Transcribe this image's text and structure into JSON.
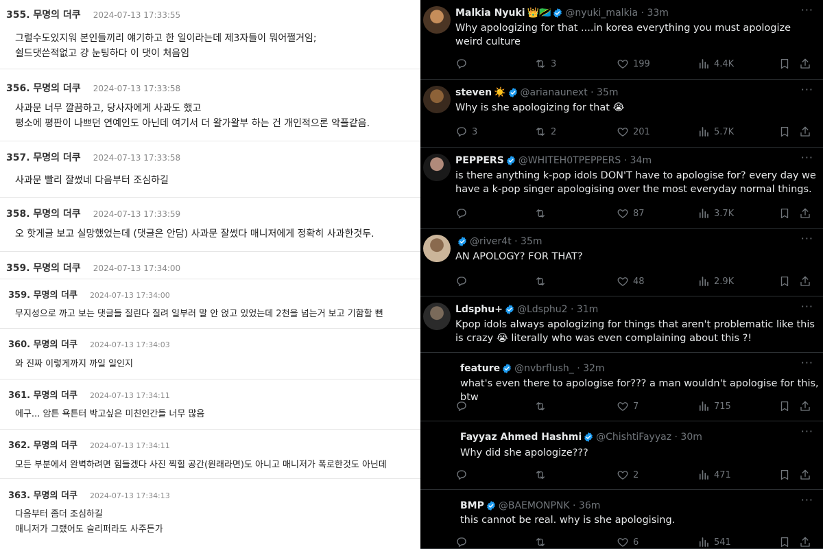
{
  "forum": {
    "comments": [
      {
        "num": "355. 무명의 더쿠",
        "time": "2024-07-13 17:33:55",
        "lines": [
          "그럴수도있지워 본인들끼리 얘기하고 한 일이라는데 제3자들이 뭐어쩔거임;",
          "쉴드댓쓴적없고 걍 눈팅하다 이 댓이 처음임"
        ]
      },
      {
        "num": "356. 무명의 더쿠",
        "time": "2024-07-13 17:33:58",
        "lines": [
          "사과문 너무 깔끔하고, 당사자에게 사과도 했고",
          "평소에 평판이 나쁘던 연예인도 아닌데 여기서 더 왈가왈부 하는 건 개인적으론 악플같음."
        ]
      },
      {
        "num": "357. 무명의 더쿠",
        "time": "2024-07-13 17:33:58",
        "lines": [
          "사과문 빨리 잘썼네 다음부터 조심하길"
        ]
      },
      {
        "num": "358. 무명의 더쿠",
        "time": "2024-07-13 17:33:59",
        "lines": [
          "오 핫게글 보고 실망했었는데 (댓글은 안담) 사과문 잘썼다 매니저에게 정확히 사과한것두."
        ]
      },
      {
        "num": "359. 무명의 더쿠",
        "time": "2024-07-13 17:34:00",
        "lines": []
      },
      {
        "num": "359. 무명의 더쿠",
        "time": "2024-07-13 17:34:00",
        "lines": [
          "무지성으로 까고 보는 댓글들 질린다 질려 일부러 말 안 얹고 있었는데 2천을 넘는거 보고 기함할 뻔"
        ]
      },
      {
        "num": "360. 무명의 더쿠",
        "time": "2024-07-13 17:34:03",
        "lines": [
          "와 진짜 이렇게까지 까일 일인지"
        ]
      },
      {
        "num": "361. 무명의 더쿠",
        "time": "2024-07-13 17:34:11",
        "lines": [
          "에구... 암튼 욕튼터 박고싶은 미친인간들 너무 많음"
        ]
      },
      {
        "num": "362. 무명의 더쿠",
        "time": "2024-07-13 17:34:11",
        "lines": [
          "모든 부분에서 완벽하려면 힘들겠다 사진 찍힐 공간(원래라면)도 아니고 매니저가 폭로한것도 아닌데"
        ]
      },
      {
        "num": "363. 무명의 더쿠",
        "time": "2024-07-13 17:34:13",
        "lines": [
          "다음부터 좀더 조심하길",
          "매니저가 그랬어도 슬리퍼라도 사주든가"
        ]
      }
    ]
  },
  "twitter": {
    "colors": {
      "background": "#000000",
      "text": "#e7e9ea",
      "muted": "#71767b",
      "verified": "#1d9bf0",
      "divider": "#2f3336"
    },
    "tweets": [
      {
        "name": "Malkia Nyuki",
        "emoji": "👑🇹🇿",
        "handle": "@nyuki_malkia",
        "time": "· 33m",
        "text": "Why apologizing for that ....in korea everything you must apologize weird culture",
        "replies": "",
        "retweets": "3",
        "likes": "199",
        "views": "4.4K"
      },
      {
        "name": "steven",
        "emoji": "☀️",
        "handle": "@arianaunext",
        "time": "· 35m",
        "text": "Why is she apologizing for that 😭",
        "replies": "3",
        "retweets": "2",
        "likes": "201",
        "views": "5.7K"
      },
      {
        "name": "PEPPERS",
        "emoji": "",
        "handle": "@WHITEH0TPEPPERS",
        "time": "· 34m",
        "text": "is there anything k-pop idols DON'T have to apologise for? every day we have a k-pop singer apologising over the most everyday normal things.",
        "replies": "",
        "retweets": "",
        "likes": "87",
        "views": "3.7K"
      },
      {
        "name": "",
        "emoji": "",
        "handle": "@river4t",
        "time": "· 35m",
        "text": "AN APOLOGY? FOR THAT?",
        "replies": "",
        "retweets": "",
        "likes": "48",
        "views": "2.9K"
      },
      {
        "name": "Ldsphu+",
        "emoji": "",
        "handle": "@Ldsphu2",
        "time": "· 31m",
        "text": "Kpop idols always apologizing for things that aren't problematic like this is crazy 😭 literally who was even complaining about this ?!",
        "replies": "",
        "retweets": "",
        "likes": "",
        "views": ""
      },
      {
        "name": "feature",
        "emoji": "",
        "handle": "@nvbrflush_",
        "time": "· 32m",
        "text": "what's even there to apologise for??? a man wouldn't apologise for this, btw",
        "replies": "",
        "retweets": "",
        "likes": "7",
        "views": "715"
      },
      {
        "name": "Fayyaz Ahmed Hashmi",
        "emoji": "",
        "handle": "@ChishtiFayyaz",
        "time": "· 30m",
        "text": "Why did she apologize???",
        "replies": "",
        "retweets": "",
        "likes": "2",
        "views": "471"
      },
      {
        "name": "BMP",
        "emoji": "",
        "handle": "@BAEMONPNK",
        "time": "· 36m",
        "text": "this cannot be real. why is she apologising.",
        "replies": "",
        "retweets": "",
        "likes": "6",
        "views": "541"
      }
    ]
  }
}
